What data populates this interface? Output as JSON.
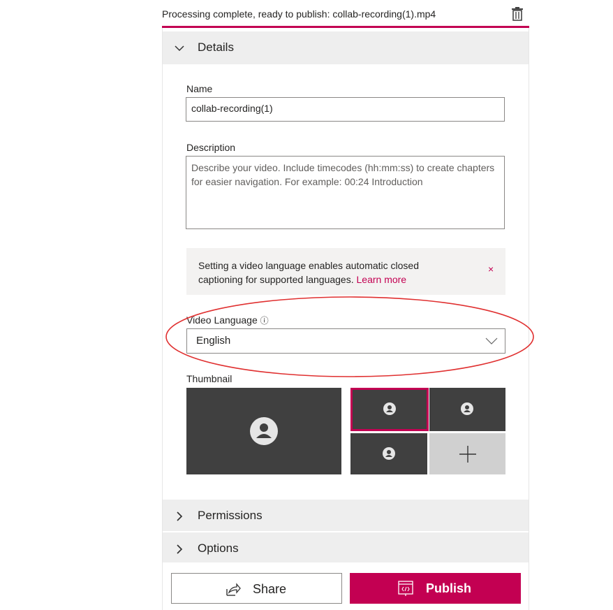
{
  "status": {
    "message": "Processing complete, ready to publish: collab-recording(1).mp4",
    "delete_icon": "trash-icon"
  },
  "sections": {
    "details": {
      "label": "Details",
      "expanded": true
    },
    "permissions": {
      "label": "Permissions",
      "expanded": false
    },
    "options": {
      "label": "Options",
      "expanded": false
    }
  },
  "form": {
    "name_label": "Name",
    "name_value": "collab-recording(1)",
    "description_label": "Description",
    "description_placeholder": "Describe your video. Include timecodes (hh:mm:ss) to create chapters for easier navigation. For example: 00:24 Introduction",
    "banner_text": "Setting a video language enables automatic closed captioning for supported languages.",
    "banner_link": "Learn more",
    "banner_close": "×",
    "language_label": "Video Language",
    "language_info_icon": "ⓘ",
    "language_value": "English",
    "thumbnail_label": "Thumbnail"
  },
  "thumbnails": {
    "selected_index": 0,
    "add_icon": "plus-icon"
  },
  "actions": {
    "share_label": "Share",
    "publish_label": "Publish"
  },
  "colors": {
    "accent": "#c30052",
    "thumbnail_bg": "#404040",
    "section_bg": "#eeeeee",
    "annotation": "#e03030"
  }
}
